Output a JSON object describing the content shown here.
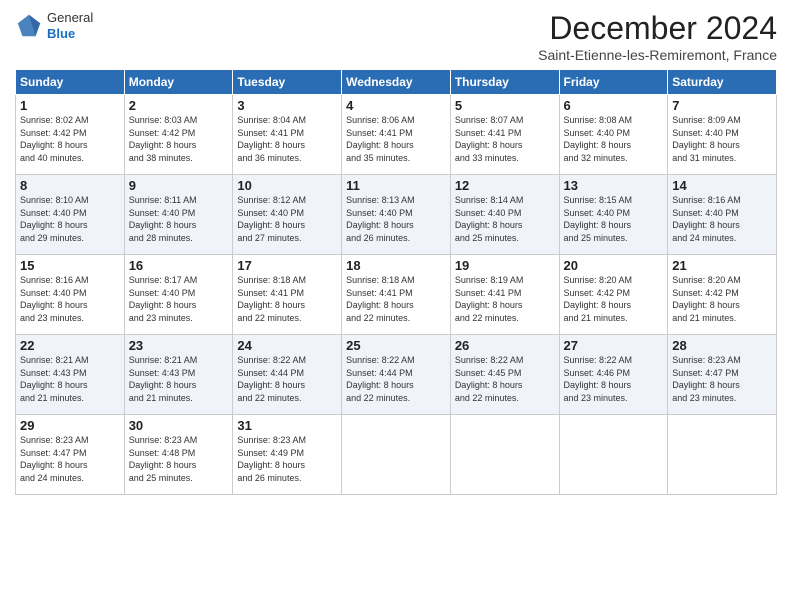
{
  "logo": {
    "general": "General",
    "blue": "Blue"
  },
  "title": "December 2024",
  "location": "Saint-Etienne-les-Remiremont, France",
  "days_of_week": [
    "Sunday",
    "Monday",
    "Tuesday",
    "Wednesday",
    "Thursday",
    "Friday",
    "Saturday"
  ],
  "weeks": [
    [
      {
        "day": "1",
        "info": "Sunrise: 8:02 AM\nSunset: 4:42 PM\nDaylight: 8 hours\nand 40 minutes."
      },
      {
        "day": "2",
        "info": "Sunrise: 8:03 AM\nSunset: 4:42 PM\nDaylight: 8 hours\nand 38 minutes."
      },
      {
        "day": "3",
        "info": "Sunrise: 8:04 AM\nSunset: 4:41 PM\nDaylight: 8 hours\nand 36 minutes."
      },
      {
        "day": "4",
        "info": "Sunrise: 8:06 AM\nSunset: 4:41 PM\nDaylight: 8 hours\nand 35 minutes."
      },
      {
        "day": "5",
        "info": "Sunrise: 8:07 AM\nSunset: 4:41 PM\nDaylight: 8 hours\nand 33 minutes."
      },
      {
        "day": "6",
        "info": "Sunrise: 8:08 AM\nSunset: 4:40 PM\nDaylight: 8 hours\nand 32 minutes."
      },
      {
        "day": "7",
        "info": "Sunrise: 8:09 AM\nSunset: 4:40 PM\nDaylight: 8 hours\nand 31 minutes."
      }
    ],
    [
      {
        "day": "8",
        "info": "Sunrise: 8:10 AM\nSunset: 4:40 PM\nDaylight: 8 hours\nand 29 minutes."
      },
      {
        "day": "9",
        "info": "Sunrise: 8:11 AM\nSunset: 4:40 PM\nDaylight: 8 hours\nand 28 minutes."
      },
      {
        "day": "10",
        "info": "Sunrise: 8:12 AM\nSunset: 4:40 PM\nDaylight: 8 hours\nand 27 minutes."
      },
      {
        "day": "11",
        "info": "Sunrise: 8:13 AM\nSunset: 4:40 PM\nDaylight: 8 hours\nand 26 minutes."
      },
      {
        "day": "12",
        "info": "Sunrise: 8:14 AM\nSunset: 4:40 PM\nDaylight: 8 hours\nand 25 minutes."
      },
      {
        "day": "13",
        "info": "Sunrise: 8:15 AM\nSunset: 4:40 PM\nDaylight: 8 hours\nand 25 minutes."
      },
      {
        "day": "14",
        "info": "Sunrise: 8:16 AM\nSunset: 4:40 PM\nDaylight: 8 hours\nand 24 minutes."
      }
    ],
    [
      {
        "day": "15",
        "info": "Sunrise: 8:16 AM\nSunset: 4:40 PM\nDaylight: 8 hours\nand 23 minutes."
      },
      {
        "day": "16",
        "info": "Sunrise: 8:17 AM\nSunset: 4:40 PM\nDaylight: 8 hours\nand 23 minutes."
      },
      {
        "day": "17",
        "info": "Sunrise: 8:18 AM\nSunset: 4:41 PM\nDaylight: 8 hours\nand 22 minutes."
      },
      {
        "day": "18",
        "info": "Sunrise: 8:18 AM\nSunset: 4:41 PM\nDaylight: 8 hours\nand 22 minutes."
      },
      {
        "day": "19",
        "info": "Sunrise: 8:19 AM\nSunset: 4:41 PM\nDaylight: 8 hours\nand 22 minutes."
      },
      {
        "day": "20",
        "info": "Sunrise: 8:20 AM\nSunset: 4:42 PM\nDaylight: 8 hours\nand 21 minutes."
      },
      {
        "day": "21",
        "info": "Sunrise: 8:20 AM\nSunset: 4:42 PM\nDaylight: 8 hours\nand 21 minutes."
      }
    ],
    [
      {
        "day": "22",
        "info": "Sunrise: 8:21 AM\nSunset: 4:43 PM\nDaylight: 8 hours\nand 21 minutes."
      },
      {
        "day": "23",
        "info": "Sunrise: 8:21 AM\nSunset: 4:43 PM\nDaylight: 8 hours\nand 21 minutes."
      },
      {
        "day": "24",
        "info": "Sunrise: 8:22 AM\nSunset: 4:44 PM\nDaylight: 8 hours\nand 22 minutes."
      },
      {
        "day": "25",
        "info": "Sunrise: 8:22 AM\nSunset: 4:44 PM\nDaylight: 8 hours\nand 22 minutes."
      },
      {
        "day": "26",
        "info": "Sunrise: 8:22 AM\nSunset: 4:45 PM\nDaylight: 8 hours\nand 22 minutes."
      },
      {
        "day": "27",
        "info": "Sunrise: 8:22 AM\nSunset: 4:46 PM\nDaylight: 8 hours\nand 23 minutes."
      },
      {
        "day": "28",
        "info": "Sunrise: 8:23 AM\nSunset: 4:47 PM\nDaylight: 8 hours\nand 23 minutes."
      }
    ],
    [
      {
        "day": "29",
        "info": "Sunrise: 8:23 AM\nSunset: 4:47 PM\nDaylight: 8 hours\nand 24 minutes."
      },
      {
        "day": "30",
        "info": "Sunrise: 8:23 AM\nSunset: 4:48 PM\nDaylight: 8 hours\nand 25 minutes."
      },
      {
        "day": "31",
        "info": "Sunrise: 8:23 AM\nSunset: 4:49 PM\nDaylight: 8 hours\nand 26 minutes."
      },
      {
        "day": "",
        "info": ""
      },
      {
        "day": "",
        "info": ""
      },
      {
        "day": "",
        "info": ""
      },
      {
        "day": "",
        "info": ""
      }
    ]
  ]
}
